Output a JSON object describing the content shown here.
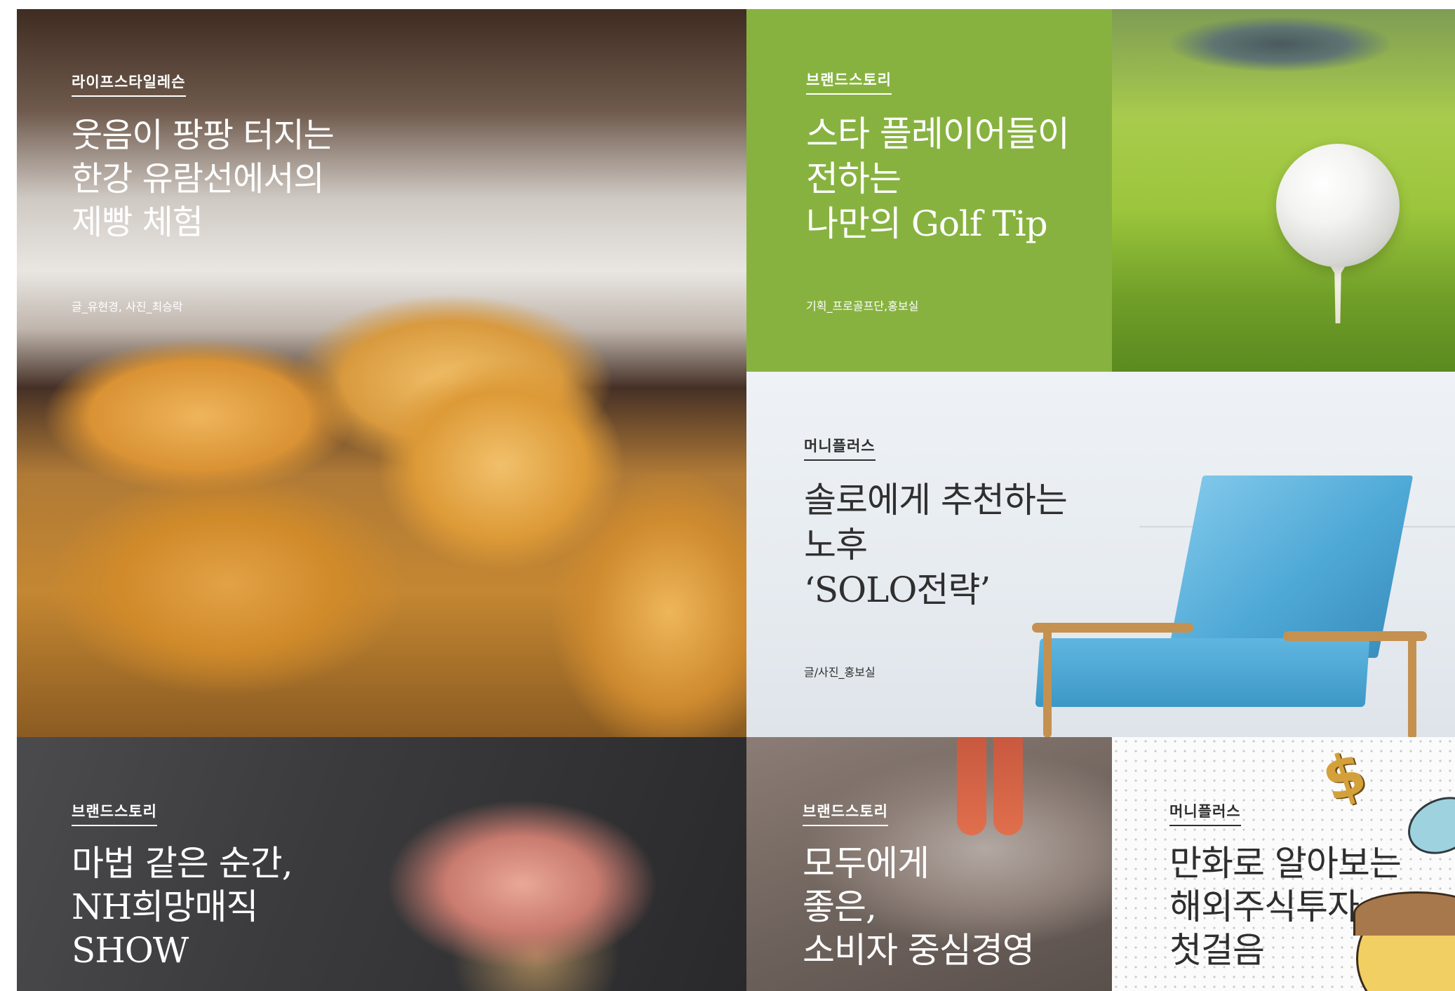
{
  "tiles": {
    "bread": {
      "category": "라이프스타일레슨",
      "headline": [
        "웃음이 팡팡 터지는",
        "한강 유람선에서의",
        "제빵 체험"
      ],
      "credit": "글_유현경, 사진_최승락"
    },
    "golf": {
      "category": "브랜드스토리",
      "headline": [
        "스타 플레이어들이",
        "전하는",
        "나만의 Golf Tip"
      ],
      "credit": "기획_프로골프단,홍보실"
    },
    "chair": {
      "category": "머니플러스",
      "headline": [
        "솔로에게 추천하는",
        "노후",
        "‘SOLO전략’"
      ],
      "credit": "글/사진_홍보실"
    },
    "magic": {
      "category": "브랜드스토리",
      "headline": [
        "마법 같은 순간,",
        "NH희망매직",
        "SHOW"
      ]
    },
    "consumer": {
      "category": "브랜드스토리",
      "headline": [
        "모두에게",
        "좋은,",
        "소비자 중심경영"
      ]
    },
    "comic": {
      "category": "머니플러스",
      "headline": [
        "만화로 알아보는",
        "해외주식투자",
        "첫걸음"
      ]
    }
  },
  "icons": {
    "golf_ball": "golf-ball-icon",
    "chair": "armchair-icon",
    "dollar": "dollar-sign-icon"
  },
  "colors": {
    "golf_green": "#87b240",
    "chair_blue": "#4fa9d6",
    "consumer_orange": "#e06f4d"
  }
}
